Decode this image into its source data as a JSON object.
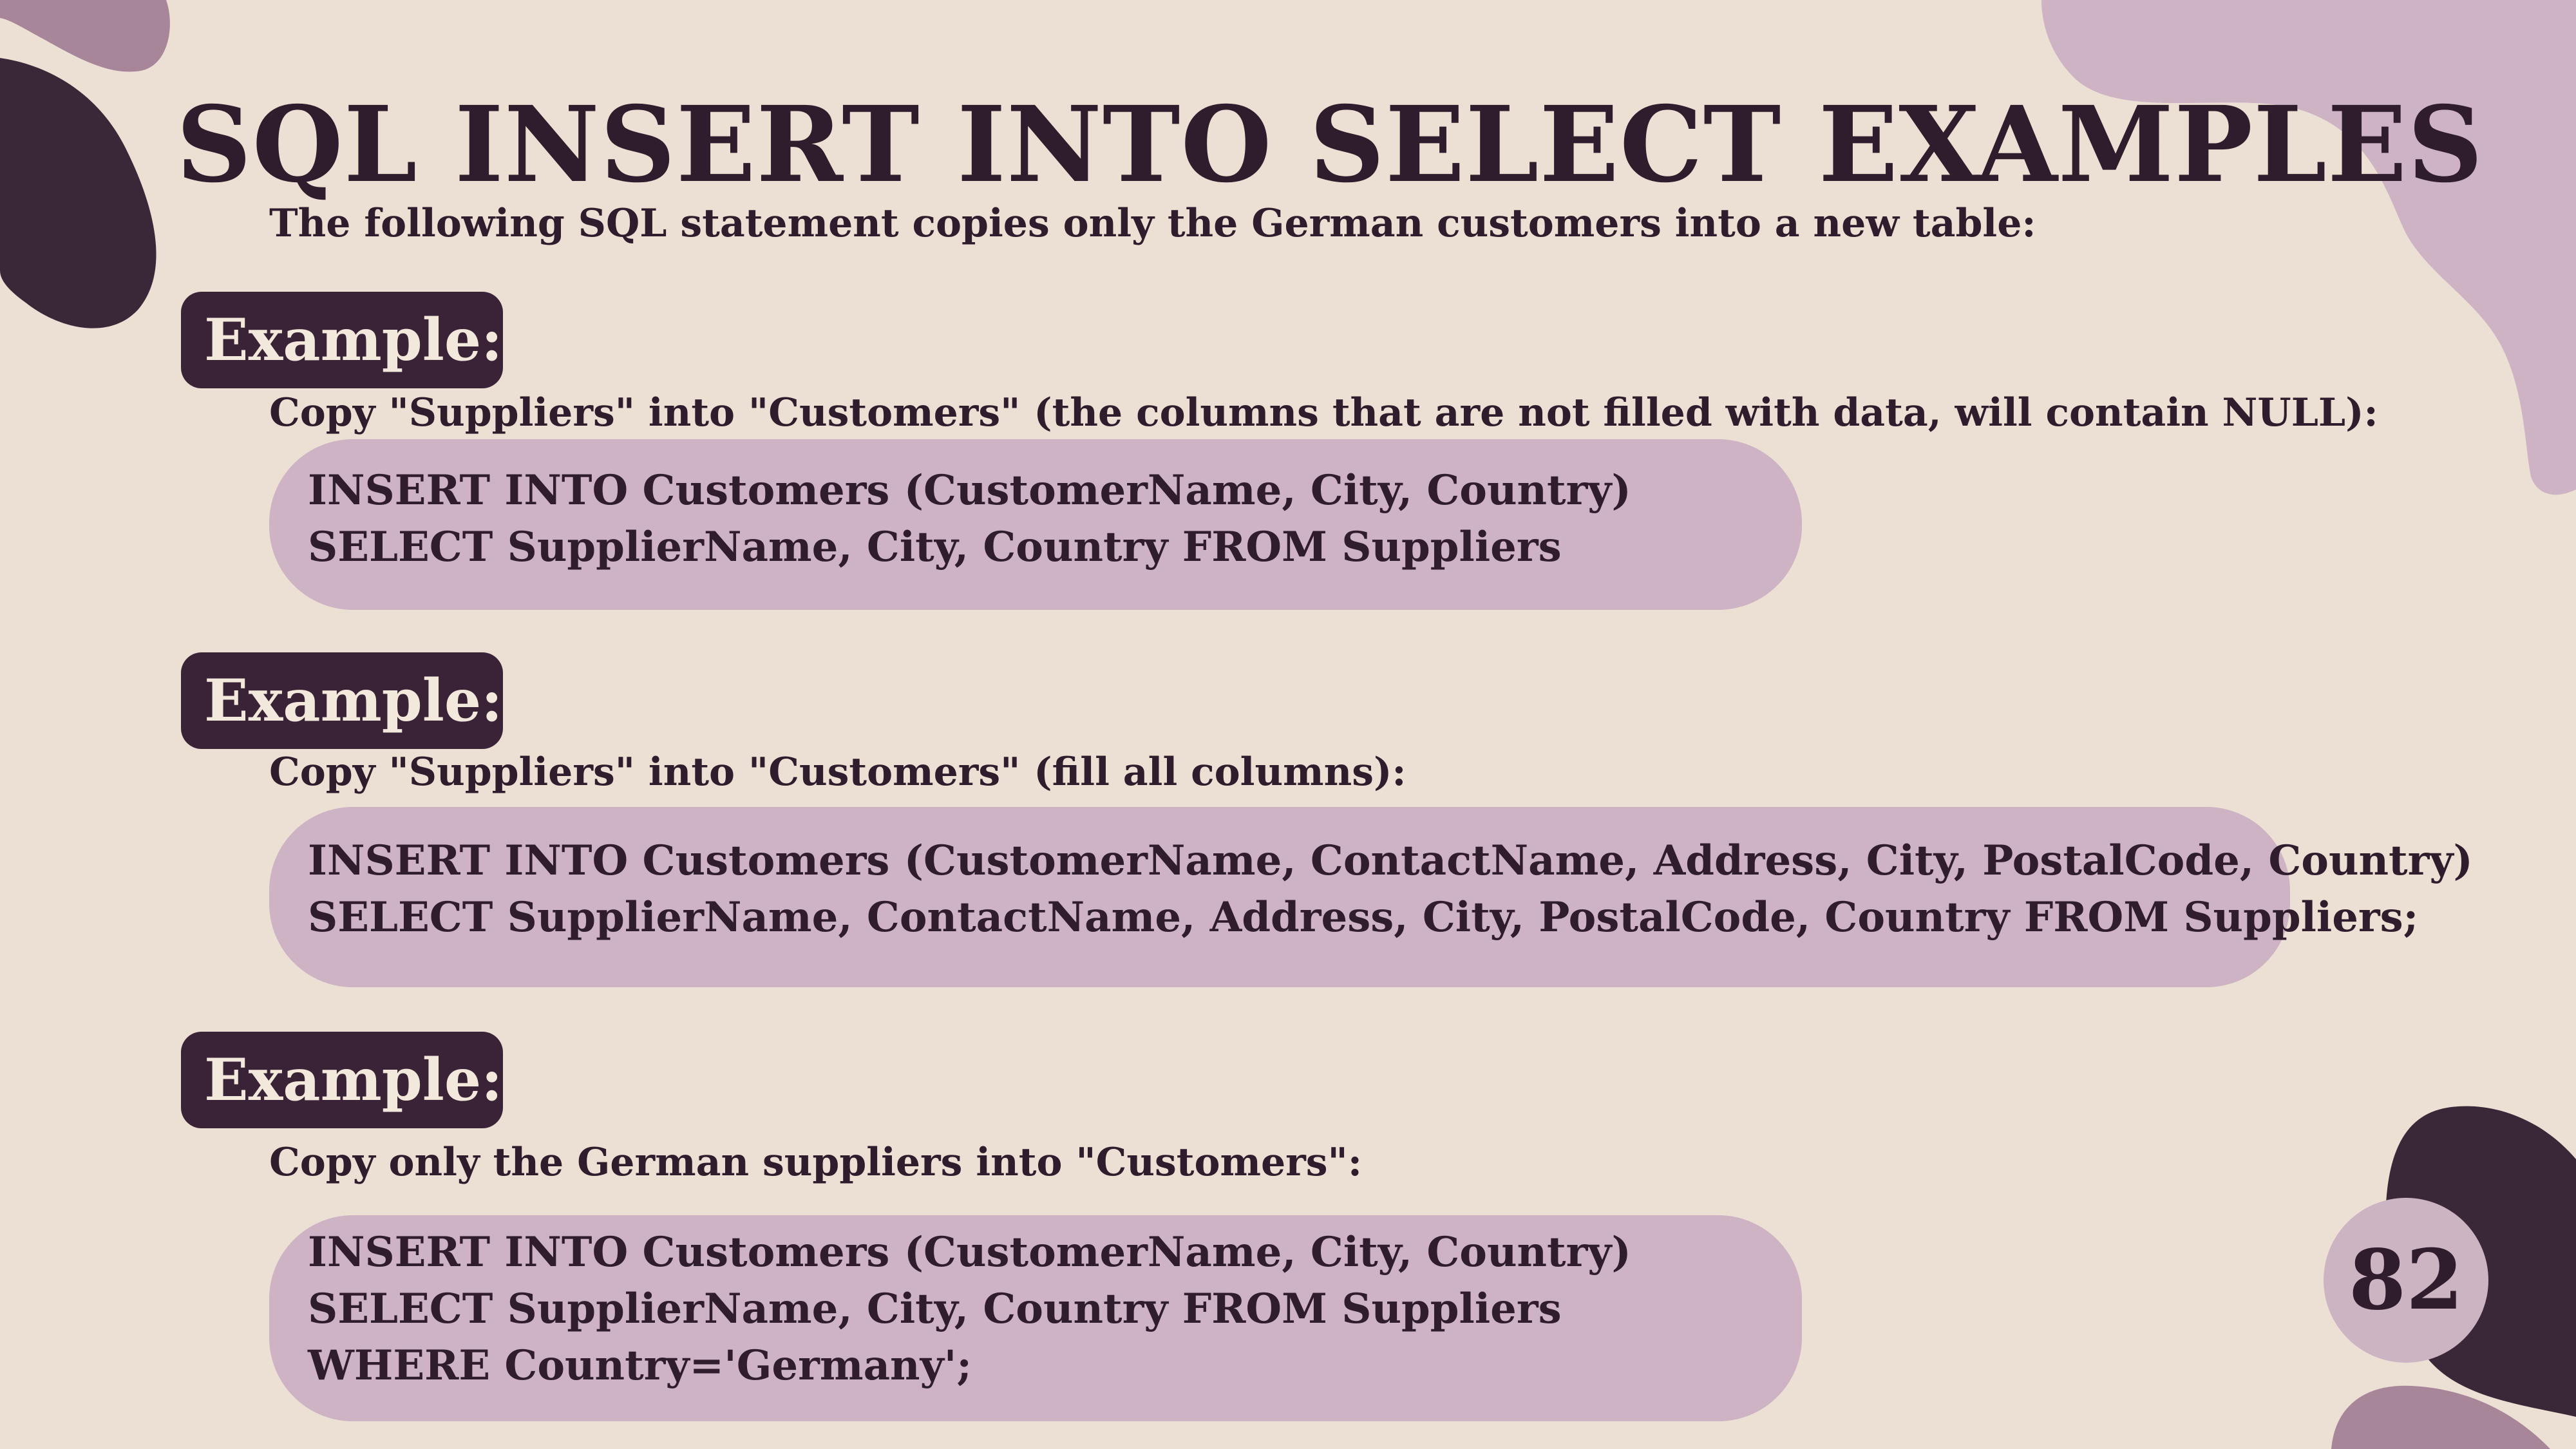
{
  "slide": {
    "title": "SQL INSERT INTO SELECT EXAMPLES",
    "intro": "The following SQL statement copies only the German customers into a new table:",
    "page_number": "82"
  },
  "examples": [
    {
      "label": "Example:",
      "description": "Copy \"Suppliers\" into \"Customers\" (the columns that are not filled with data, will contain NULL):",
      "code": [
        "INSERT INTO Customers (CustomerName, City, Country)",
        "SELECT SupplierName, City, Country FROM Suppliers"
      ]
    },
    {
      "label": "Example:",
      "description": "Copy \"Suppliers\" into \"Customers\" (fill all columns):",
      "code": [
        "INSERT INTO Customers (CustomerName, ContactName, Address, City, PostalCode, Country)",
        "SELECT SupplierName, ContactName, Address, City, PostalCode, Country FROM Suppliers;"
      ]
    },
    {
      "label": "Example:",
      "description": "Copy only the German suppliers into \"Customers\":",
      "code": [
        "INSERT INTO Customers (CustomerName, City, Country)",
        "SELECT SupplierName, City, Country FROM Suppliers",
        "WHERE Country='Germany';"
      ]
    }
  ],
  "colors": {
    "background": "#ece0d4",
    "dark_plum": "#3a2336",
    "mauve": "#cdb3c3",
    "text": "#2f1c2c"
  }
}
